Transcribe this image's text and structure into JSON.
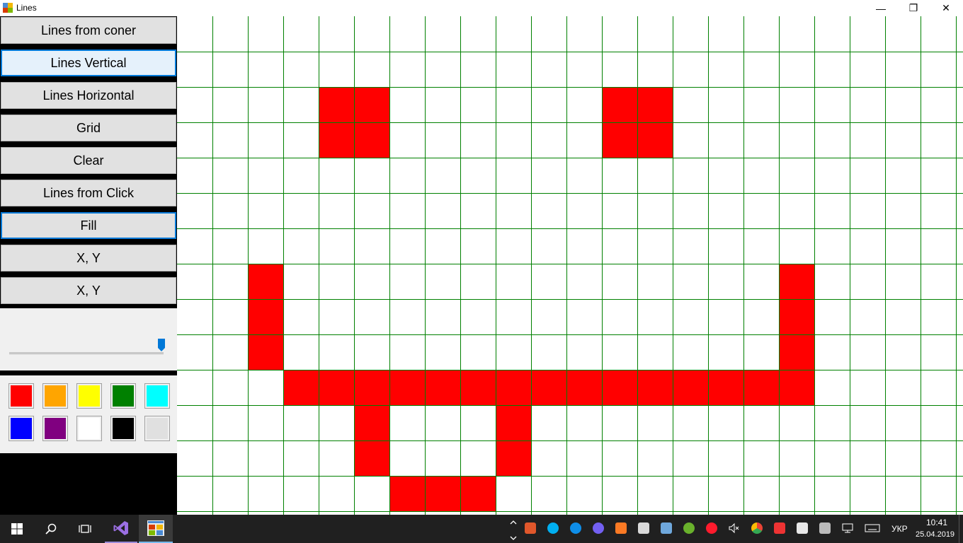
{
  "window": {
    "title": "Lines",
    "minimize_glyph": "—",
    "restore_glyph": "❐",
    "close_glyph": "✕"
  },
  "buttons": [
    {
      "label": "Lines from coner"
    },
    {
      "label": "Lines Vertical"
    },
    {
      "label": "Lines Horizontal"
    },
    {
      "label": "Grid"
    },
    {
      "label": "Clear"
    },
    {
      "label": "Lines from Click"
    },
    {
      "label": "Fill"
    },
    {
      "label": "X, Y"
    },
    {
      "label": "X, Y"
    }
  ],
  "slider": {
    "value": 1.0
  },
  "palette": {
    "colors": [
      "#ff0000",
      "#ffa500",
      "#ffff00",
      "#008000",
      "#00ffff",
      "#0000ff",
      "#800080",
      "#ffffff",
      "#000000",
      "#e0e0e0"
    ]
  },
  "canvas": {
    "grid_color": "#008000",
    "fill_color": "#ff0000",
    "background": "#ffffff",
    "columns": 23,
    "rows": 15,
    "filled_cells": [
      [
        4,
        2
      ],
      [
        5,
        2
      ],
      [
        4,
        3
      ],
      [
        5,
        3
      ],
      [
        12,
        2
      ],
      [
        13,
        2
      ],
      [
        12,
        3
      ],
      [
        13,
        3
      ],
      [
        2,
        7
      ],
      [
        2,
        8
      ],
      [
        2,
        9
      ],
      [
        17,
        7
      ],
      [
        17,
        8
      ],
      [
        17,
        9
      ],
      [
        17,
        10
      ],
      [
        3,
        10
      ],
      [
        4,
        10
      ],
      [
        5,
        10
      ],
      [
        6,
        10
      ],
      [
        7,
        10
      ],
      [
        8,
        10
      ],
      [
        9,
        10
      ],
      [
        10,
        10
      ],
      [
        11,
        10
      ],
      [
        12,
        10
      ],
      [
        13,
        10
      ],
      [
        14,
        10
      ],
      [
        15,
        10
      ],
      [
        16,
        10
      ],
      [
        5,
        11
      ],
      [
        5,
        12
      ],
      [
        9,
        11
      ],
      [
        9,
        12
      ],
      [
        6,
        13
      ],
      [
        7,
        13
      ],
      [
        8,
        13
      ]
    ]
  },
  "taskbar": {
    "language": "УКР",
    "time": "10:41",
    "date": "25.04.2019",
    "tray_icons": [
      "chevron-up",
      "app-icon",
      "skype-icon",
      "teamviewer-icon",
      "viber-icon",
      "xampp-icon",
      "dropbox-icon",
      "network-drive-icon",
      "utorrent-icon",
      "opera-icon",
      "volume-muted-icon",
      "chrome-icon",
      "cloud-icon",
      "shield-icon",
      "usb-icon",
      "network-icon",
      "keyboard-icon"
    ]
  }
}
